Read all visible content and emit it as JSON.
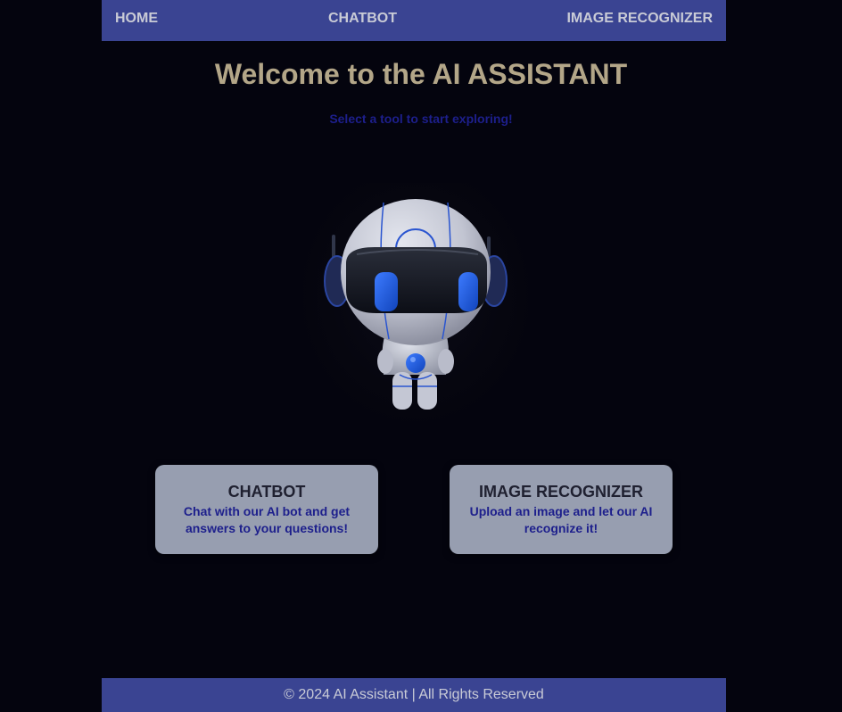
{
  "nav": {
    "home": "HOME",
    "chatbot": "CHATBOT",
    "image_recognizer": "IMAGE RECOGNIZER"
  },
  "hero": {
    "title": "Welcome to the AI ASSISTANT",
    "subtitle": "Select a tool to start exploring!"
  },
  "cards": [
    {
      "title": "CHATBOT",
      "description": "Chat with our AI bot and get answers to your questions!"
    },
    {
      "title": "IMAGE RECOGNIZER",
      "description": "Upload an image and let our AI recognize it!"
    }
  ],
  "footer": {
    "text": "© 2024 AI Assistant | All Rights Reserved"
  },
  "colors": {
    "background": "#04040e",
    "nav_bg": "#3a4492",
    "title": "#b3a688",
    "accent_blue": "#1d1f8c",
    "card_bg": "#979eb0"
  },
  "icons": {
    "hero_image": "robot-mascot"
  }
}
